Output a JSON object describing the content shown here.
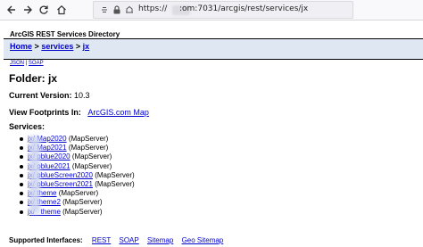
{
  "browser": {
    "url_prefix": "https://",
    "url_visible": ":om:7031/arcgis/rest/services/jx"
  },
  "page": {
    "site_title": "ArcGIS REST Services Directory",
    "breadcrumb": {
      "home": "Home",
      "sep1": ">",
      "services": "services",
      "sep2": ">",
      "current": "jx"
    },
    "formats": {
      "json": "JSON",
      "divider": "|",
      "soap": "SOAP"
    },
    "folder_title": "Folder: jx",
    "current_version_label": "Current Version:",
    "current_version_value": "10.3",
    "footprints_label": "View Footprints In:",
    "footprints_link": "ArcGIS.com Map",
    "services_label": "Services:",
    "services": [
      {
        "name": "jx/      Map2020",
        "kind": "(MapServer)"
      },
      {
        "name": "jx/      Map2021",
        "kind": "(MapServer)"
      },
      {
        "name": "jx/     pblue2020",
        "kind": "(MapServer)"
      },
      {
        "name": "jx/     pblue2021",
        "kind": "(MapServer)"
      },
      {
        "name": "jx/     pblueScreen2020",
        "kind": "(MapServer)"
      },
      {
        "name": "jx/     pblueScreen2021",
        "kind": "(MapServer)"
      },
      {
        "name": "jx/     theme",
        "kind": "(MapServer)"
      },
      {
        "name": "jx/     theme2",
        "kind": "(MapServer)"
      },
      {
        "name": "jx/      _theme",
        "kind": "(MapServer)"
      }
    ],
    "interfaces": {
      "label": "Supported Interfaces:",
      "rest": "REST",
      "soap": "SOAP",
      "sitemap": "Sitemap",
      "geo_sitemap": "Geo Sitemap"
    }
  },
  "colors": {
    "link": "#0000cc",
    "band": "#dfe8f2"
  }
}
